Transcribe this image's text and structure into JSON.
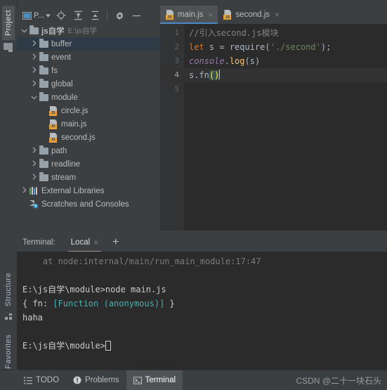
{
  "left_tool_strip": {
    "top_tabs": [
      {
        "label": "Project",
        "icon": "project-folder-icon",
        "active": true
      }
    ],
    "bottom_tabs": [
      {
        "label": "Structure",
        "icon": "structure-icon",
        "active": false
      },
      {
        "label": "Favorites",
        "icon": "star-icon",
        "active": false
      }
    ]
  },
  "project_toolbar": {
    "scope_label": "P...",
    "buttons": [
      {
        "name": "project-scope-selector",
        "icon": "window-icon",
        "label": "P..."
      },
      {
        "name": "select-opened-file",
        "icon": "crosshair-target-icon"
      },
      {
        "name": "expand-all",
        "icon": "expand-all-icon"
      },
      {
        "name": "collapse-all",
        "icon": "collapse-all-icon"
      },
      {
        "name": "settings",
        "icon": "gear-icon"
      },
      {
        "name": "hide-panel",
        "icon": "minimize-icon"
      }
    ]
  },
  "project_tree": [
    {
      "label": "js自学",
      "sub": "E:\\js自学",
      "icon": "folder-icon",
      "depth": 0,
      "arrow": "v",
      "bold": true,
      "selected": false
    },
    {
      "label": "buffer",
      "sub": "",
      "icon": "folder-icon",
      "depth": 1,
      "arrow": ">",
      "bold": false,
      "selected": true
    },
    {
      "label": "event",
      "sub": "",
      "icon": "folder-icon",
      "depth": 1,
      "arrow": ">",
      "bold": false,
      "selected": false
    },
    {
      "label": "fs",
      "sub": "",
      "icon": "folder-icon",
      "depth": 1,
      "arrow": ">",
      "bold": false,
      "selected": false
    },
    {
      "label": "global",
      "sub": "",
      "icon": "folder-icon",
      "depth": 1,
      "arrow": ">",
      "bold": false,
      "selected": false
    },
    {
      "label": "module",
      "sub": "",
      "icon": "folder-icon",
      "depth": 1,
      "arrow": "v",
      "bold": false,
      "selected": false
    },
    {
      "label": "circle.js",
      "sub": "",
      "icon": "js-file-icon",
      "depth": 2,
      "arrow": "",
      "bold": false,
      "selected": false
    },
    {
      "label": "main.js",
      "sub": "",
      "icon": "js-file-icon",
      "depth": 2,
      "arrow": "",
      "bold": false,
      "selected": false
    },
    {
      "label": "second.js",
      "sub": "",
      "icon": "js-file-icon",
      "depth": 2,
      "arrow": "",
      "bold": false,
      "selected": false
    },
    {
      "label": "path",
      "sub": "",
      "icon": "folder-icon",
      "depth": 1,
      "arrow": ">",
      "bold": false,
      "selected": false
    },
    {
      "label": "readline",
      "sub": "",
      "icon": "folder-icon",
      "depth": 1,
      "arrow": ">",
      "bold": false,
      "selected": false
    },
    {
      "label": "stream",
      "sub": "",
      "icon": "folder-icon",
      "depth": 1,
      "arrow": ">",
      "bold": false,
      "selected": false
    },
    {
      "label": "External Libraries",
      "sub": "",
      "icon": "libraries-icon",
      "depth": 0,
      "arrow": ">",
      "bold": false,
      "selected": false
    },
    {
      "label": "Scratches and Consoles",
      "sub": "",
      "icon": "scratches-icon",
      "depth": 0,
      "arrow": "",
      "bold": false,
      "selected": false
    }
  ],
  "editor": {
    "tabs": [
      {
        "label": "main.js",
        "icon": "js-file-icon",
        "active": true,
        "close": "×"
      },
      {
        "label": "second.js",
        "icon": "js-file-icon",
        "active": false,
        "close": "×"
      }
    ],
    "line_numbers": [
      "1",
      "2",
      "3",
      "4",
      "5"
    ],
    "current_line": 4,
    "lines": [
      {
        "n": 1,
        "tokens": [
          {
            "t": "//引入second.js模块",
            "c": "c-com"
          }
        ]
      },
      {
        "n": 2,
        "tokens": [
          {
            "t": "let",
            "c": "c-kw"
          },
          {
            "t": " s = ",
            "c": "c-var"
          },
          {
            "t": "require",
            "c": "c-fn"
          },
          {
            "t": "(",
            "c": "c-var"
          },
          {
            "t": "'./second'",
            "c": "c-str"
          },
          {
            "t": ");",
            "c": "c-var"
          }
        ]
      },
      {
        "n": 3,
        "tokens": [
          {
            "t": "console",
            "c": "c-cls"
          },
          {
            "t": ".",
            "c": "c-var"
          },
          {
            "t": "log",
            "c": "c-meth"
          },
          {
            "t": "(s)",
            "c": "c-var"
          }
        ]
      },
      {
        "n": 4,
        "tokens": [
          {
            "t": "s.fn",
            "c": "c-var"
          },
          {
            "t": "()",
            "c": "c-pm"
          }
        ]
      },
      {
        "n": 5,
        "tokens": []
      }
    ]
  },
  "terminal": {
    "title": "Terminal:",
    "tabs": [
      {
        "label": "Local",
        "close": "×",
        "active": true
      }
    ],
    "new_tab": "+",
    "output": [
      {
        "text": "    at node:internal/main/run_main_module:17:47",
        "cls": "t-dim"
      },
      {
        "text": "",
        "cls": ""
      },
      {
        "text": "E:\\js自学\\module>node main.js",
        "cls": ""
      },
      {
        "text": "{ fn: [Function (anonymous)] }",
        "cls": "mixed-fn"
      },
      {
        "text": "haha",
        "cls": ""
      },
      {
        "text": "",
        "cls": ""
      },
      {
        "text": "E:\\js自学\\module>",
        "cls": "prompt"
      }
    ],
    "obj_line": {
      "prefix": "{ fn: ",
      "highlight": "[Function (anonymous)]",
      "suffix": " }"
    }
  },
  "status_bar": {
    "items": [
      {
        "label": "TODO",
        "icon": "todo-list-icon",
        "active": false
      },
      {
        "label": "Problems",
        "icon": "problems-warning-icon",
        "active": false
      },
      {
        "label": "Terminal",
        "icon": "terminal-icon",
        "active": true
      }
    ],
    "watermark": "CSDN @二十一块石头"
  },
  "colors": {
    "panel_bg": "#3C3F41",
    "editor_bg": "#2B2B2B",
    "gutter_bg": "#313335",
    "selection_bg": "#2F3A47",
    "accent_blue": "#4A88C7",
    "active_tab_bg": "#4E5254",
    "text": "#BBBBBB",
    "js_icon_yellow": "#E8A33D",
    "keyword_orange": "#CC7832",
    "string_green": "#6A8759",
    "class_purple": "#9876AA",
    "method_yellow": "#FFC66D"
  }
}
